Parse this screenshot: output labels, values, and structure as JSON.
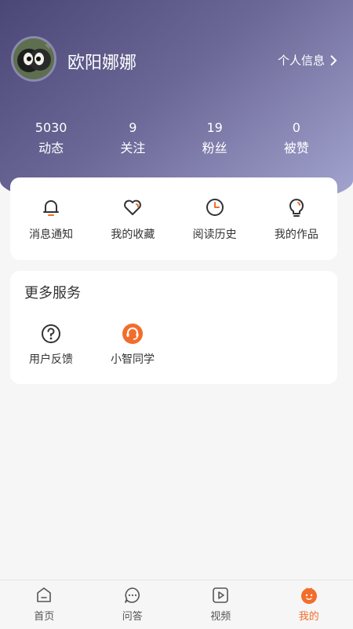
{
  "profile": {
    "name": "欧阳娜娜",
    "info_link": "个人信息"
  },
  "stats": [
    {
      "value": "5030",
      "label": "动态"
    },
    {
      "value": "9",
      "label": "关注"
    },
    {
      "value": "19",
      "label": "粉丝"
    },
    {
      "value": "0",
      "label": "被赞"
    }
  ],
  "quick_actions": [
    {
      "label": "消息通知",
      "icon": "bell-icon"
    },
    {
      "label": "我的收藏",
      "icon": "heart-icon"
    },
    {
      "label": "阅读历史",
      "icon": "clock-icon"
    },
    {
      "label": "我的作品",
      "icon": "lightbulb-icon"
    }
  ],
  "services": {
    "title": "更多服务",
    "items": [
      {
        "label": "用户反馈",
        "icon": "question-icon"
      },
      {
        "label": "小智同学",
        "icon": "headset-icon"
      }
    ]
  },
  "tabbar": [
    {
      "label": "首页",
      "icon": "home-icon"
    },
    {
      "label": "问答",
      "icon": "chat-icon"
    },
    {
      "label": "视频",
      "icon": "video-icon"
    },
    {
      "label": "我的",
      "icon": "user-icon",
      "active": true
    }
  ],
  "colors": {
    "accent": "#f26d2b",
    "header_start": "#4a4676",
    "header_end": "#a6a7d2"
  }
}
